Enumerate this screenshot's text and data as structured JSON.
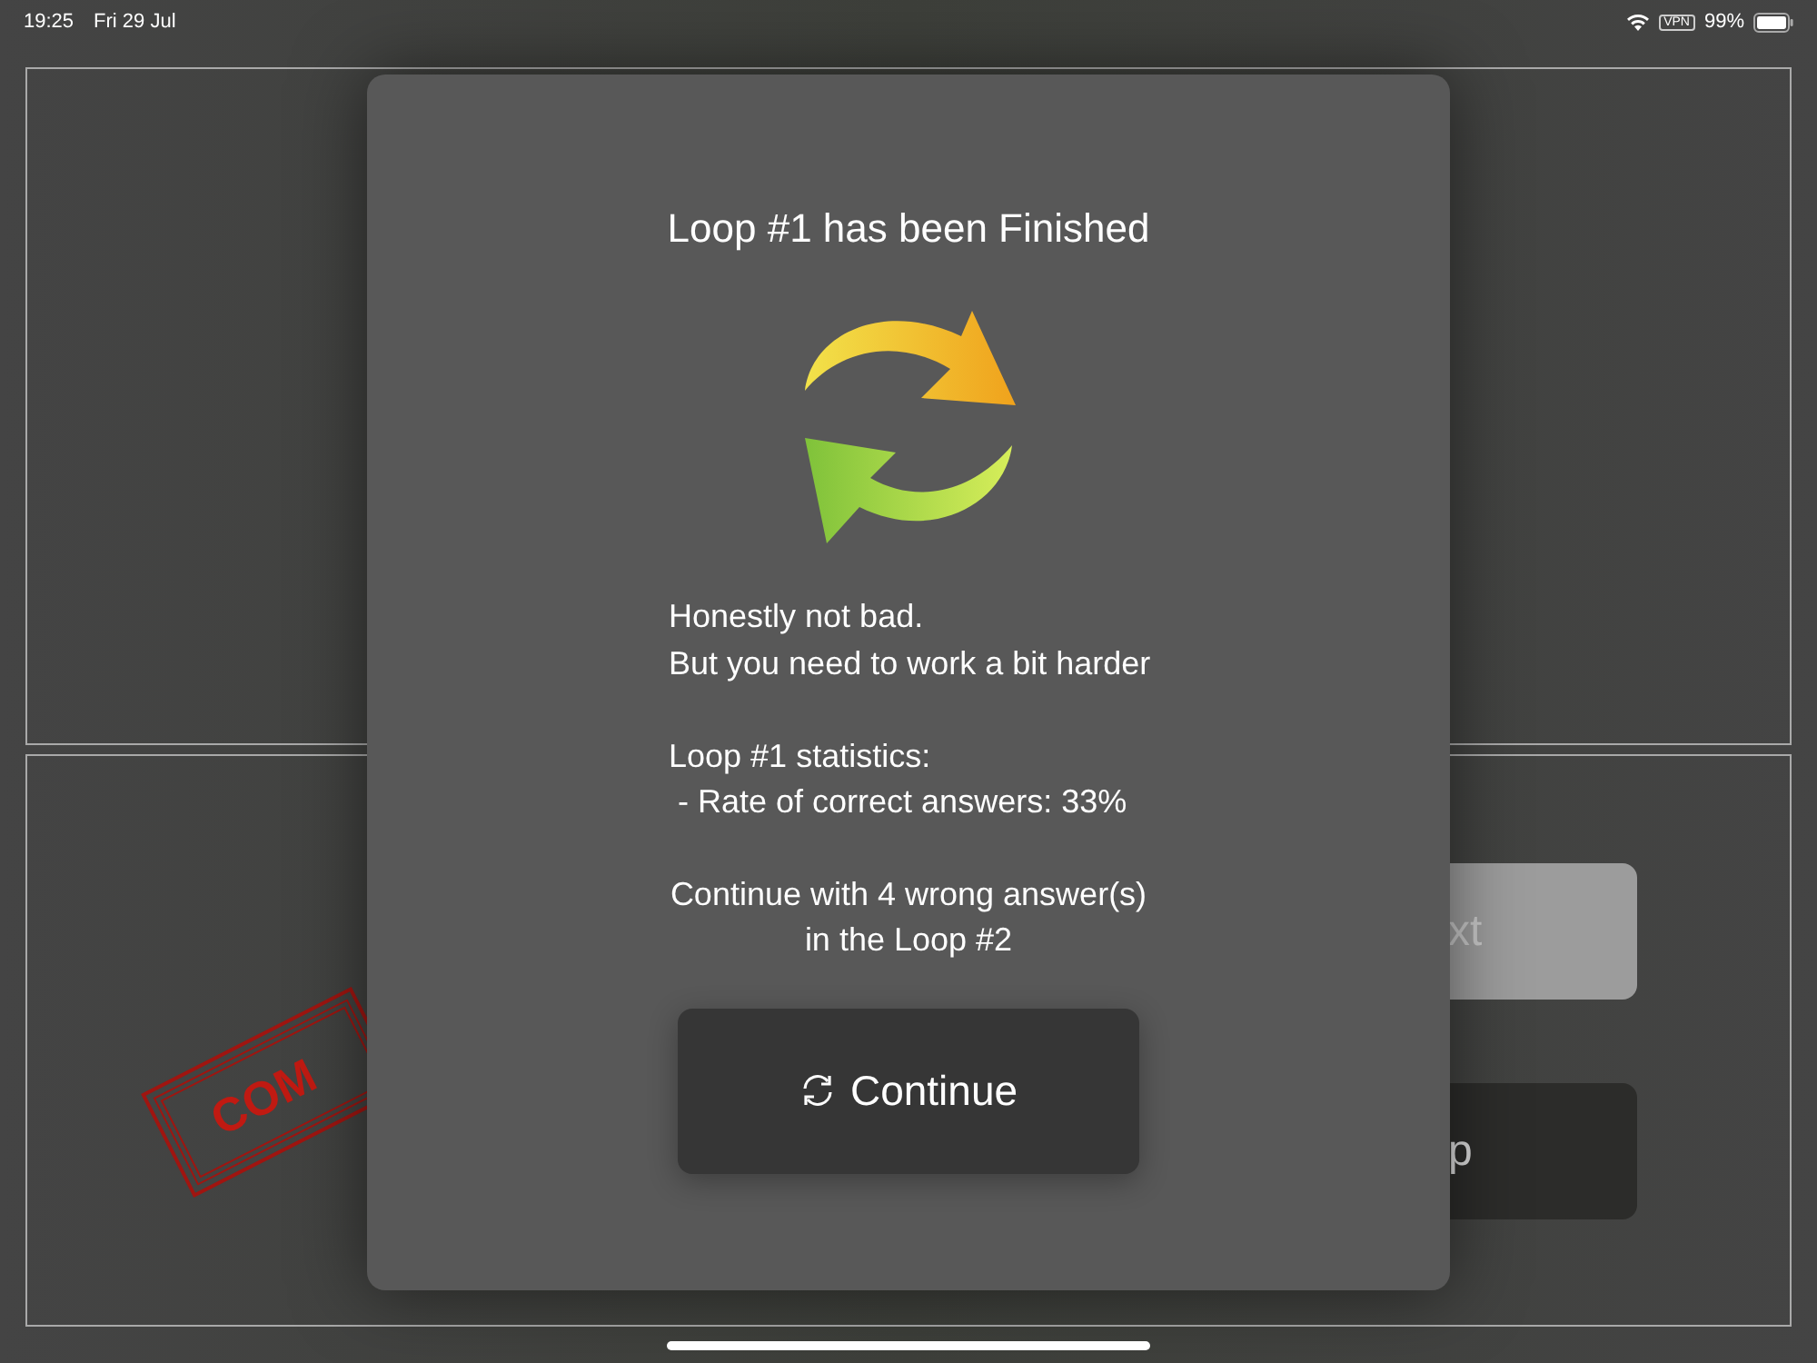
{
  "status_bar": {
    "time": "19:25",
    "date": "Fri 29 Jul",
    "vpn": "VPN",
    "battery": "99%"
  },
  "background": {
    "stamp": "COM",
    "buttons": [
      {
        "label": "xt",
        "disabled": true
      },
      {
        "label": "p",
        "disabled": false
      }
    ]
  },
  "dialog": {
    "title": "Loop #1 has been Finished",
    "message": [
      {
        "lines": [
          "Honestly not bad.",
          "But you need to work a bit harder"
        ]
      },
      {
        "lines": [
          "Loop #1 statistics:",
          " - Rate of correct answers: 33%"
        ]
      }
    ],
    "footer": [
      "Continue with 4 wrong answer(s)",
      "in the Loop #2"
    ],
    "button": "Continue"
  }
}
